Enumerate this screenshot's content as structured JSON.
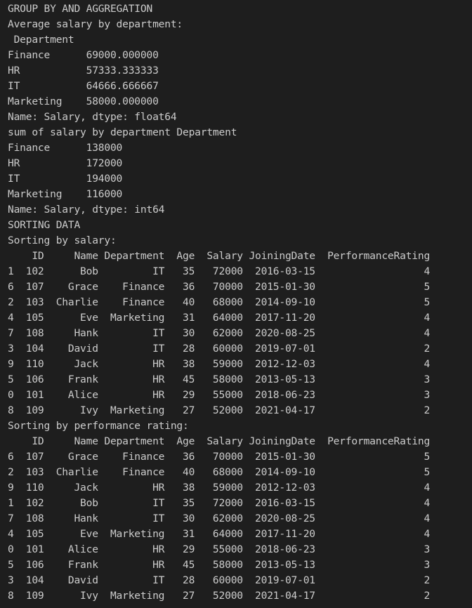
{
  "terminal": {
    "lines": [
      "GROUP BY AND AGGREGATION",
      "Average salary by department:",
      " Department",
      "Finance      69000.000000",
      "HR           57333.333333",
      "IT           64666.666667",
      "Marketing    58000.000000",
      "Name: Salary, dtype: float64",
      "sum of salary by department Department",
      "Finance      138000",
      "HR           172000",
      "IT           194000",
      "Marketing    116000",
      "Name: Salary, dtype: int64",
      "SORTING DATA",
      "Sorting by salary:",
      "    ID     Name Department  Age  Salary JoiningDate  PerformanceRating",
      "1  102      Bob         IT   35   72000  2016-03-15                  4",
      "6  107    Grace    Finance   36   70000  2015-01-30                  5",
      "2  103  Charlie    Finance   40   68000  2014-09-10                  5",
      "4  105      Eve  Marketing   31   64000  2017-11-20                  4",
      "7  108     Hank         IT   30   62000  2020-08-25                  4",
      "3  104    David         IT   28   60000  2019-07-01                  2",
      "9  110     Jack         HR   38   59000  2012-12-03                  4",
      "5  106    Frank         HR   45   58000  2013-05-13                  3",
      "0  101    Alice         HR   29   55000  2018-06-23                  3",
      "8  109      Ivy  Marketing   27   52000  2021-04-17                  2",
      "Sorting by performance rating:",
      "    ID     Name Department  Age  Salary JoiningDate  PerformanceRating",
      "6  107    Grace    Finance   36   70000  2015-01-30                  5",
      "2  103  Charlie    Finance   40   68000  2014-09-10                  5",
      "9  110     Jack         HR   38   59000  2012-12-03                  4",
      "1  102      Bob         IT   35   72000  2016-03-15                  4",
      "7  108     Hank         IT   30   62000  2020-08-25                  4",
      "4  105      Eve  Marketing   31   64000  2017-11-20                  4",
      "0  101    Alice         HR   29   55000  2018-06-23                  3",
      "5  106    Frank         HR   45   58000  2013-05-13                  3",
      "3  104    David         IT   28   60000  2019-07-01                  2",
      "8  109      Ivy  Marketing   27   52000  2021-04-17                  2"
    ]
  }
}
